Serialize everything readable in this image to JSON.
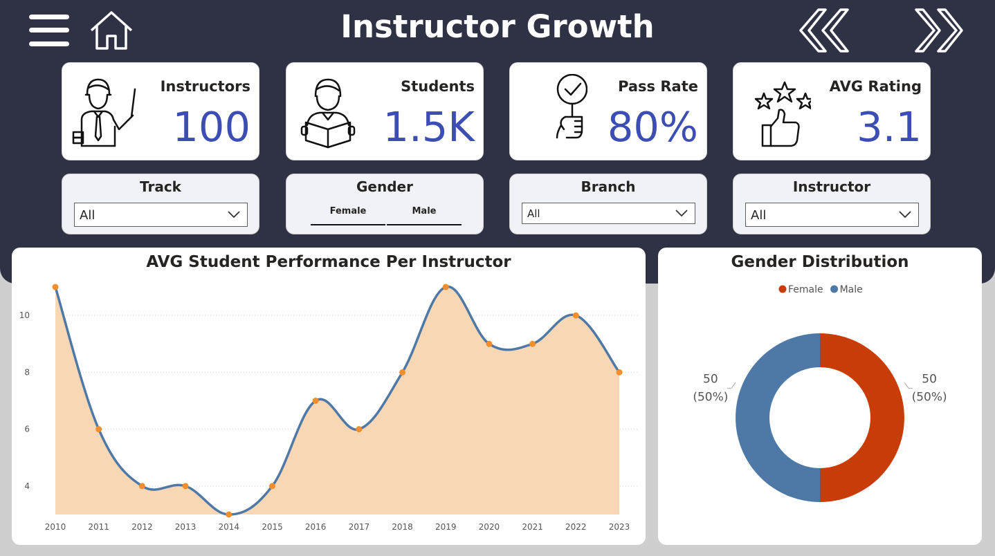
{
  "header": {
    "title": "Instructor Growth"
  },
  "icons": {
    "menu": "hamburger-icon",
    "home": "home-icon",
    "prev": "double-chevron-left-icon",
    "next": "double-chevron-right-icon"
  },
  "kpis": [
    {
      "label": "Instructors",
      "value": "100",
      "icon": "instructor-icon"
    },
    {
      "label": "Students",
      "value": "1.5K",
      "icon": "student-reading-icon"
    },
    {
      "label": "Pass Rate",
      "value": "80%",
      "icon": "check-sign-icon"
    },
    {
      "label": "AVG Rating",
      "value": "3.1",
      "icon": "rating-stars-thumbs-up-icon"
    }
  ],
  "slicers": {
    "track": {
      "title": "Track",
      "value": "All"
    },
    "gender": {
      "title": "Gender",
      "options": [
        "Female",
        "Male"
      ]
    },
    "branch": {
      "title": "Branch",
      "value": "All"
    },
    "instructor": {
      "title": "Instructor",
      "value": "All"
    }
  },
  "colors": {
    "header_bg": "#2f3145",
    "kpi_value": "#3c4db3",
    "line": "#4e79a7",
    "area": "#f8d7b5",
    "point": "#f28e2b",
    "female": "#c83c07",
    "male": "#4e79a7"
  },
  "chart_data": [
    {
      "type": "area",
      "title": "AVG Student Performance Per Instructor",
      "x": [
        "2010",
        "2011",
        "2012",
        "2013",
        "2014",
        "2015",
        "2016",
        "2017",
        "2018",
        "2019",
        "2020",
        "2021",
        "2022",
        "2023"
      ],
      "values": [
        11,
        6,
        4,
        4,
        3,
        4,
        7,
        6,
        8,
        11,
        9,
        9,
        10,
        8
      ],
      "y_ticks": [
        "4",
        "6",
        "8",
        "10"
      ],
      "ylim": [
        3,
        11
      ],
      "grid": true
    },
    {
      "type": "pie",
      "subtype": "donut",
      "title": "Gender Distribution",
      "legend": "top-center",
      "slices": [
        {
          "name": "Female",
          "value": 50,
          "value_label": "50",
          "pct_label": "(50%)",
          "color": "#c83c07"
        },
        {
          "name": "Male",
          "value": 50,
          "value_label": "50",
          "pct_label": "(50%)",
          "color": "#4e79a7"
        }
      ]
    }
  ]
}
